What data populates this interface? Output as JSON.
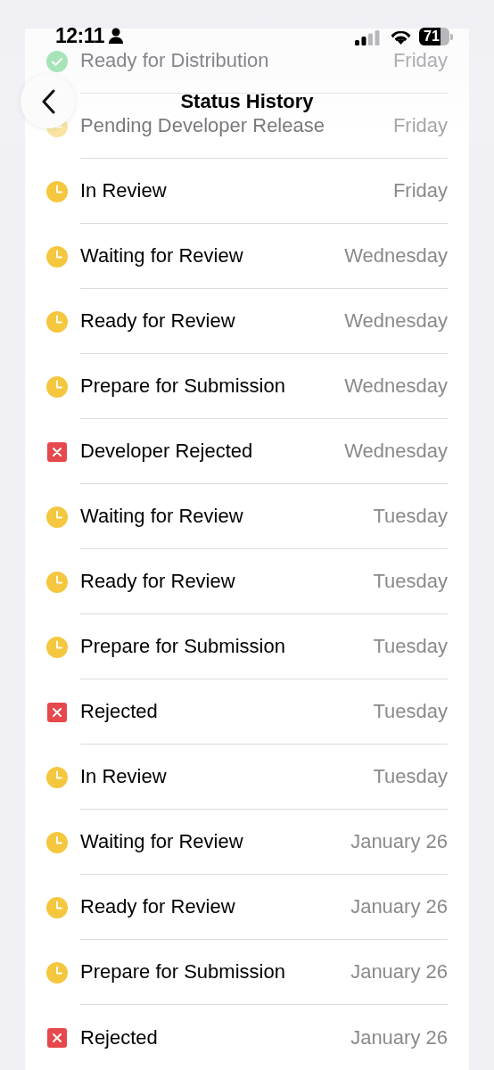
{
  "status_bar": {
    "time": "12:11",
    "battery": "71"
  },
  "header": {
    "title": "Status History"
  },
  "entries": [
    {
      "kind": "ready",
      "status": "Ready for Distribution",
      "date": "Friday",
      "obscured": true
    },
    {
      "kind": "pending",
      "status": "Pending Developer Release",
      "date": "Friday",
      "obscured": true
    },
    {
      "kind": "pending",
      "status": "In Review",
      "date": "Friday",
      "obscured": false
    },
    {
      "kind": "pending",
      "status": "Waiting for Review",
      "date": "Wednesday",
      "obscured": false
    },
    {
      "kind": "pending",
      "status": "Ready for Review",
      "date": "Wednesday",
      "obscured": false
    },
    {
      "kind": "pending",
      "status": "Prepare for Submission",
      "date": "Wednesday",
      "obscured": false
    },
    {
      "kind": "rejected",
      "status": "Developer Rejected",
      "date": "Wednesday",
      "obscured": false
    },
    {
      "kind": "pending",
      "status": "Waiting for Review",
      "date": "Tuesday",
      "obscured": false
    },
    {
      "kind": "pending",
      "status": "Ready for Review",
      "date": "Tuesday",
      "obscured": false
    },
    {
      "kind": "pending",
      "status": "Prepare for Submission",
      "date": "Tuesday",
      "obscured": false
    },
    {
      "kind": "rejected",
      "status": "Rejected",
      "date": "Tuesday",
      "obscured": false
    },
    {
      "kind": "pending",
      "status": "In Review",
      "date": "Tuesday",
      "obscured": false
    },
    {
      "kind": "pending",
      "status": "Waiting for Review",
      "date": "January 26",
      "obscured": false
    },
    {
      "kind": "pending",
      "status": "Ready for Review",
      "date": "January 26",
      "obscured": false
    },
    {
      "kind": "pending",
      "status": "Prepare for Submission",
      "date": "January 26",
      "obscured": false
    },
    {
      "kind": "rejected",
      "status": "Rejected",
      "date": "January 26",
      "obscured": false
    }
  ]
}
